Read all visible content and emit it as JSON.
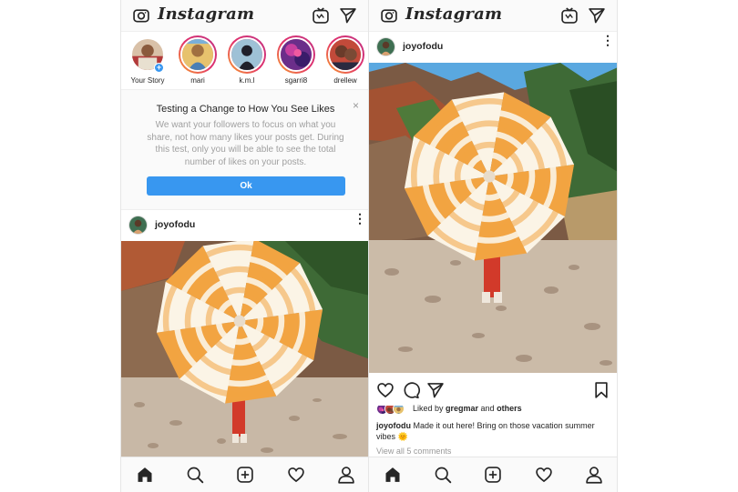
{
  "app": {
    "logo_text": "Instagram"
  },
  "stories": [
    {
      "name": "Your Story",
      "own": true
    },
    {
      "name": "mari"
    },
    {
      "name": "k.m.l"
    },
    {
      "name": "sgarri8"
    },
    {
      "name": "drellew"
    }
  ],
  "notice": {
    "title": "Testing a Change to How You See Likes",
    "body": "We want your followers to focus on what you share, not how many likes your posts get. During this test, only you will be able to see the total number of likes on your posts.",
    "ok_label": "Ok",
    "close_glyph": "×"
  },
  "post": {
    "username": "joyofodu",
    "more_glyph": "⋮",
    "liked_by_prefix": "Liked by ",
    "liked_by_user": "gregmar",
    "liked_by_suffix": " and ",
    "liked_by_others": "others",
    "caption_user": "joyofodu",
    "caption_text": " Made it out here! Bring on those vacation summer vibes 🌞",
    "view_comments": "View all 5 comments"
  },
  "colors": {
    "accent": "#3897f0",
    "story_ring": "#e1306c",
    "umbrella_stripe": "#f0a545",
    "sky": "#5aa8e0"
  },
  "icons": {
    "top": [
      "camera-icon",
      "igtv-icon",
      "direct-send-icon"
    ],
    "actions": [
      "heart-icon",
      "comment-icon",
      "share-icon",
      "bookmark-icon"
    ],
    "nav": [
      "home-icon",
      "search-icon",
      "add-post-icon",
      "activity-heart-icon",
      "profile-icon"
    ]
  }
}
